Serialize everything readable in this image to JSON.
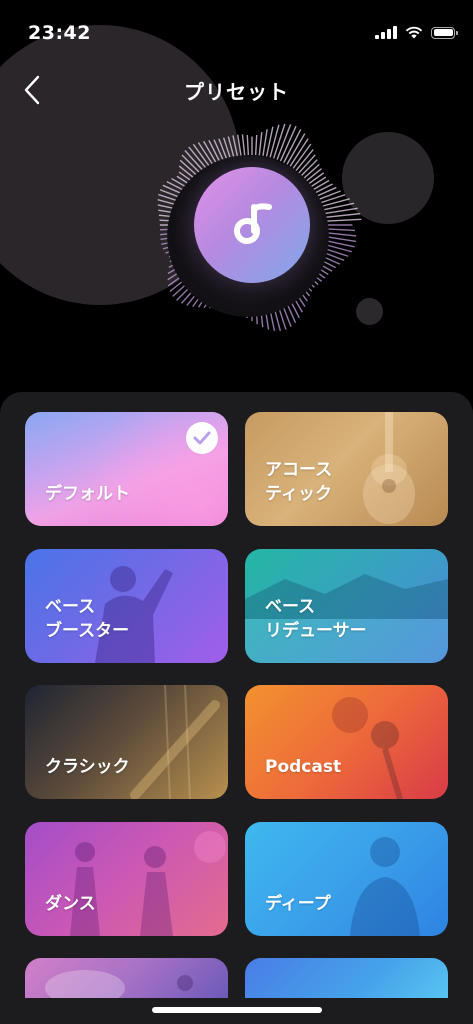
{
  "status_bar": {
    "time": "23:42"
  },
  "nav": {
    "title": "プリセット"
  },
  "colors": {
    "background": "#000000",
    "sheet": "#1c1c1e",
    "accent_gradient_start": "#e190e8",
    "accent_gradient_end": "#7fa8ea"
  },
  "presets": [
    {
      "label": "デフォルト",
      "selected": true,
      "icon": "check-icon"
    },
    {
      "label": "アコース\nティック",
      "selected": false
    },
    {
      "label": "ベース\nブースター",
      "selected": false
    },
    {
      "label": "ベース\nリデューサー",
      "selected": false
    },
    {
      "label": "クラシック",
      "selected": false
    },
    {
      "label": "Podcast",
      "selected": false
    },
    {
      "label": "ダンス",
      "selected": false
    },
    {
      "label": "ディープ",
      "selected": false
    }
  ]
}
